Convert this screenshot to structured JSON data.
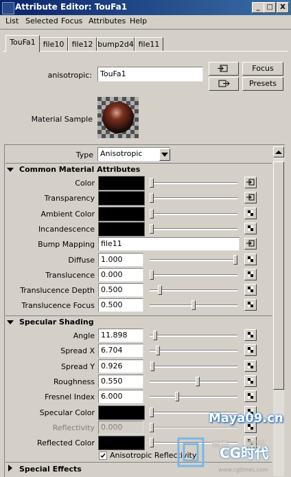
{
  "window": {
    "title": "Attribute Editor: TouFa1",
    "min": "_",
    "max": "□",
    "close": "X"
  },
  "menu": [
    "List",
    "Selected",
    "Focus",
    "Attributes",
    "Help"
  ],
  "tabs": [
    "TouFa1",
    "file10",
    "file12",
    "bump2d4",
    "file11"
  ],
  "active_tab": 0,
  "top": {
    "name_label": "anisotropic:",
    "name_value": "TouFa1",
    "focus_label": "Focus",
    "presets_label": "Presets",
    "material_sample_label": "Material Sample"
  },
  "type": {
    "label": "Type",
    "value": "Anisotropic"
  },
  "common": {
    "title": "Common Material Attributes",
    "rows": [
      {
        "label": "Color",
        "kind": "swatch",
        "slider": 0.0
      },
      {
        "label": "Transparency",
        "kind": "swatch",
        "slider": 0.0
      },
      {
        "label": "Ambient Color",
        "kind": "swatch",
        "slider": 0.0
      },
      {
        "label": "Incandescence",
        "kind": "swatch",
        "slider": 0.0
      },
      {
        "label": "Bump Mapping",
        "kind": "text",
        "value": "file11"
      },
      {
        "label": "Diffuse",
        "kind": "num",
        "value": "1.000",
        "slider": 1.0
      },
      {
        "label": "Translucence",
        "kind": "num",
        "value": "0.000",
        "slider": 0.0
      },
      {
        "label": "Translucence Depth",
        "kind": "num",
        "value": "0.500",
        "slider": 0.1
      },
      {
        "label": "Translucence Focus",
        "kind": "num",
        "value": "0.500",
        "slider": 0.5
      }
    ]
  },
  "specular": {
    "title": "Specular Shading",
    "rows": [
      {
        "label": "Angle",
        "kind": "num",
        "value": "11.898",
        "slider": 0.04
      },
      {
        "label": "Spread X",
        "kind": "num",
        "value": "6.704",
        "slider": 0.07
      },
      {
        "label": "Spread Y",
        "kind": "num",
        "value": "0.926",
        "slider": 0.01
      },
      {
        "label": "Roughness",
        "kind": "num",
        "value": "0.550",
        "slider": 0.55
      },
      {
        "label": "Fresnel Index",
        "kind": "num",
        "value": "6.000",
        "slider": 0.3
      },
      {
        "label": "Specular Color",
        "kind": "swatch",
        "slider": 0.0
      },
      {
        "label": "Reflectivity",
        "kind": "num",
        "value": "0.000",
        "slider": 0.0,
        "disabled": true
      },
      {
        "label": "Reflected Color",
        "kind": "swatch",
        "slider": 0.0
      }
    ],
    "checkbox_label": "Anisotropic Reflectivity",
    "checkbox_checked": true
  },
  "special": {
    "title": "Special Effects"
  },
  "watermark": {
    "maya": "Maya09.cn",
    "cg": "CG时代",
    "small1": "模型",
    "small2": "教程",
    "url": "www.cgtimes.com"
  }
}
